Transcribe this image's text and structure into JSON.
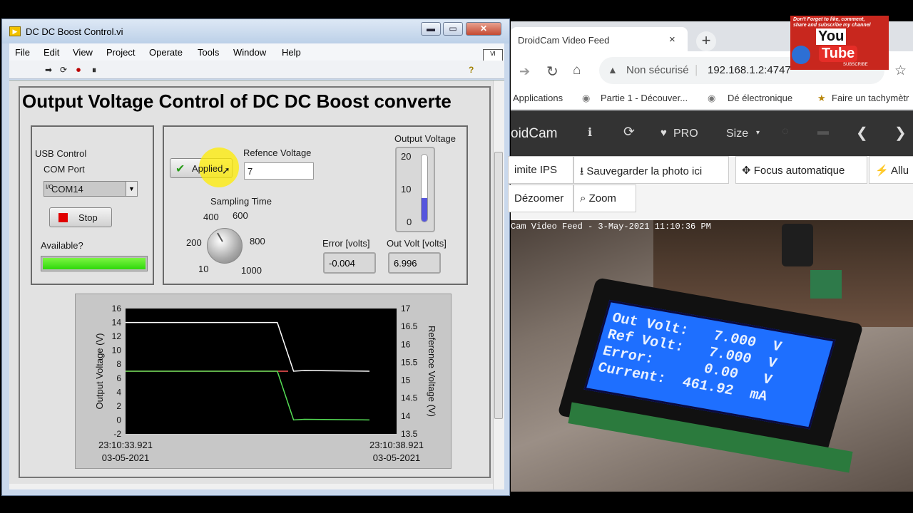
{
  "labview": {
    "title": "DC DC Boost Control.vi",
    "menu": [
      "File",
      "Edit",
      "View",
      "Project",
      "Operate",
      "Tools",
      "Window",
      "Help"
    ],
    "heading": "Output Voltage Control of DC DC Boost converte",
    "usb": {
      "title": "USB Control",
      "com_label": "COM Port",
      "com_value": "COM14",
      "com_prefix": "I/O",
      "stop_label": "Stop",
      "available_label": "Available?",
      "available": true
    },
    "control": {
      "apply_label": "Applied",
      "ref_label": "Refence Voltage",
      "ref_value": "7",
      "sampling_label": "Sampling Time",
      "knob_ticks": [
        "10",
        "200",
        "400",
        "600",
        "800",
        "1000"
      ],
      "knob_value": 400,
      "output_label": "Output Voltage",
      "thermo_ticks": [
        "20",
        "10",
        "0"
      ],
      "thermo_value": 7,
      "thermo_max": 20,
      "error_label": "Error  [volts]",
      "error_value": "-0.004",
      "outvolt_label": "Out Volt  [volts]",
      "outvolt_value": "6.996"
    },
    "chart_data": {
      "type": "line",
      "ylabel": "Output Voltage (V)",
      "y2label": "Reference  Voltage (V)",
      "ylim": [
        -2,
        16
      ],
      "y2lim": [
        13.5,
        17
      ],
      "yticks": [
        "16",
        "14",
        "12",
        "10",
        "8",
        "6",
        "4",
        "2",
        "0",
        "-2"
      ],
      "y2ticks": [
        "17",
        "16.5",
        "16",
        "15.5",
        "15",
        "14.5",
        "14",
        "13.5"
      ],
      "x_start": [
        "23:10:33.921",
        "03-05-2021"
      ],
      "x_end": [
        "23:10:38.921",
        "03-05-2021"
      ],
      "xlim": [
        0,
        5
      ],
      "series": [
        {
          "color": "#ffffff",
          "x": [
            0,
            2.8,
            3.1,
            3.3,
            4.5
          ],
          "y": [
            14,
            14,
            7,
            7.1,
            7
          ]
        },
        {
          "color": "#ff5555",
          "x": [
            0,
            2.8,
            3.0
          ],
          "y": [
            7,
            7,
            7
          ]
        },
        {
          "color": "#55dd55",
          "x": [
            0,
            2.8,
            3.1,
            3.3,
            4.5
          ],
          "y": [
            7,
            7,
            0,
            0.1,
            0
          ]
        }
      ]
    }
  },
  "chrome": {
    "tab_title": "DroidCam Video Feed",
    "tab_close": "×",
    "new_tab": "+",
    "security": "Non sécurisé",
    "url": "192.168.1.2:4747",
    "bookmarks": [
      "Applications",
      "Partie 1 - Découver...",
      "Dé électronique",
      "Faire un tachymètr"
    ],
    "droidcam": {
      "brand": "oidCam",
      "pro": "PRO",
      "size": "Size",
      "tools": [
        "imite IPS",
        "Sauvegarder la photo ici",
        "Focus automatique",
        "Allu",
        "Dézoomer",
        "Zoom"
      ]
    },
    "feed_caption": "Cam Video Feed -  3-May-2021 11:10:36 PM",
    "lcd": [
      "Out Volt:   7.000  V",
      "Ref Volt:   7.000  V",
      "Error:      0.00   V",
      "Current:  461.92  mA"
    ]
  },
  "youtube": {
    "line1": "Don't Forget to like, comment,",
    "line2": "share and subscribe my channel",
    "you": "You",
    "tube": "Tube",
    "sub": "SUBSCRIBE"
  }
}
